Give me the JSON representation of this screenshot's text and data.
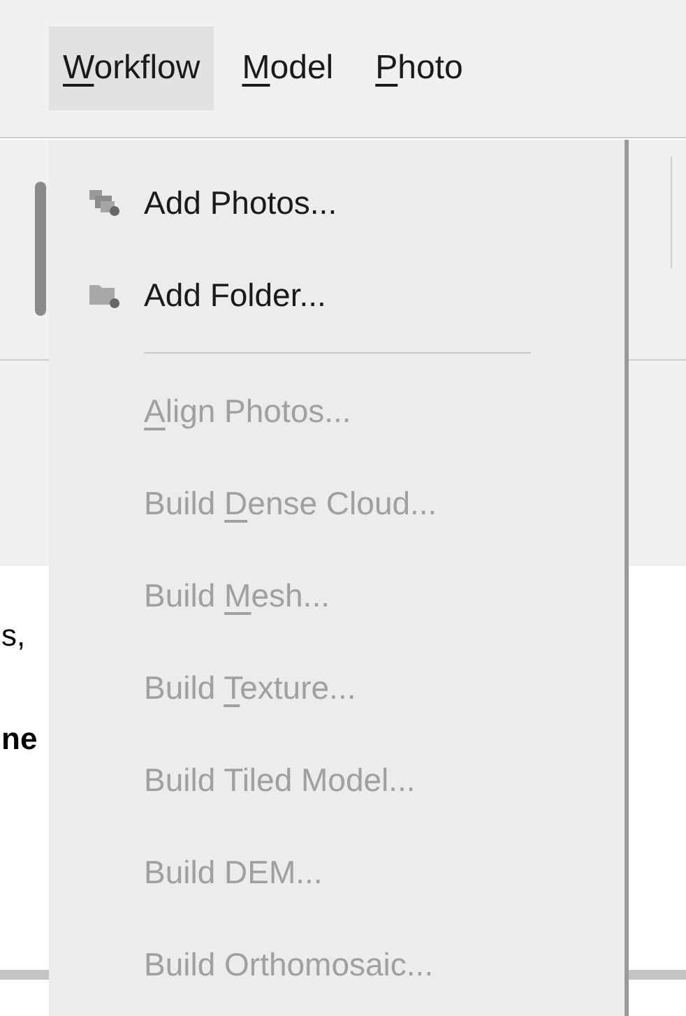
{
  "menu_bar": [
    {
      "key": "W",
      "after": "orkflow",
      "open": true
    },
    {
      "key": "M",
      "after": "odel",
      "open": false
    },
    {
      "key": "P",
      "after": "hoto",
      "open": false
    }
  ],
  "background_text": [
    {
      "text": "s,",
      "bold": false
    },
    {
      "text": "ne",
      "bold": true
    }
  ],
  "menu": [
    {
      "kind": "icon_item",
      "before": "Add Photos...",
      "disabled": false
    },
    {
      "kind": "icon_item",
      "before": "Add Folder...",
      "disabled": false
    },
    {
      "kind": "separator"
    },
    {
      "kind": "item",
      "key": "A",
      "after": "lign Photos...",
      "disabled": true
    },
    {
      "kind": "item",
      "before": "Build ",
      "key": "D",
      "after": "ense Cloud...",
      "disabled": true
    },
    {
      "kind": "item",
      "before": "Build ",
      "key": "M",
      "after": "esh...",
      "disabled": true
    },
    {
      "kind": "item",
      "before": "Build ",
      "key": "T",
      "after": "exture...",
      "disabled": true
    },
    {
      "kind": "item",
      "before": "Build Tiled Model...",
      "disabled": true
    },
    {
      "kind": "item",
      "before": "Build DEM...",
      "disabled": true
    },
    {
      "kind": "item",
      "before": "Build Orthomosaic...",
      "disabled": true
    }
  ]
}
